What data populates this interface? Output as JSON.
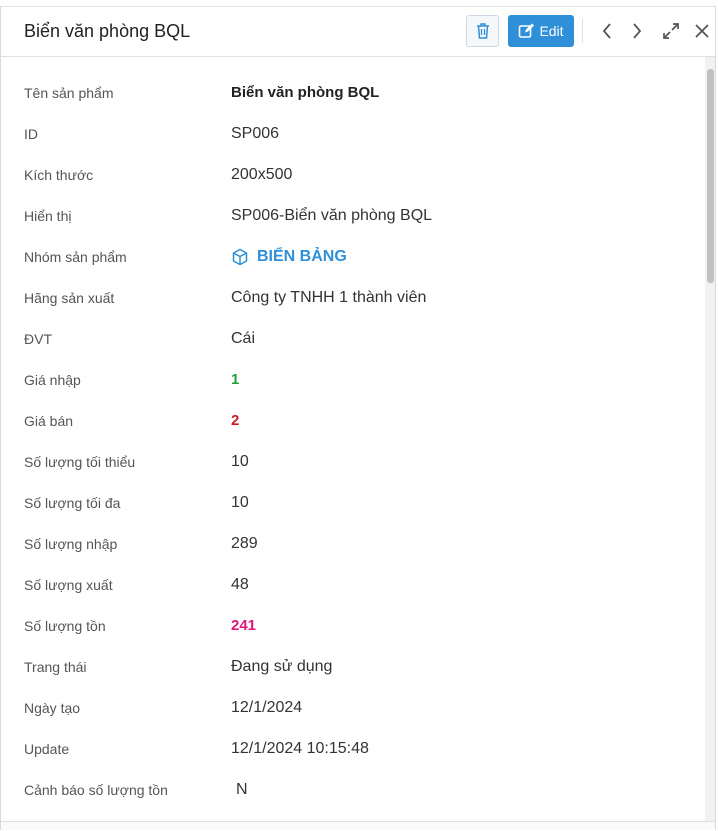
{
  "header": {
    "title": "Biển văn phòng BQL",
    "edit_label": "Edit"
  },
  "icons": {
    "delete": "trash-icon",
    "edit": "edit-icon",
    "prev": "chevron-left-icon",
    "next": "chevron-right-icon",
    "expand": "expand-icon",
    "close": "close-icon",
    "category": "cube-icon"
  },
  "colors": {
    "accent": "#2f8fd8",
    "green": "#23a03a",
    "red": "#d0192a",
    "pink": "#e0157a"
  },
  "fields": [
    {
      "label": "Tên sản phẩm",
      "value": "Biển văn phòng BQL"
    },
    {
      "label": "ID",
      "value": "SP006"
    },
    {
      "label": "Kích thước",
      "value": "200x500"
    },
    {
      "label": "Hiển thị",
      "value": "SP006-Biển văn phòng BQL"
    },
    {
      "label": "Nhóm sản phẩm",
      "value": "BIỂN BẢNG"
    },
    {
      "label": "Hãng sản xuất",
      "value": "Công ty TNHH 1 thành viên"
    },
    {
      "label": "ĐVT",
      "value": "Cái"
    },
    {
      "label": "Giá nhập",
      "value": "1"
    },
    {
      "label": "Giá bán",
      "value": "2"
    },
    {
      "label": "Số lượng tối thiểu",
      "value": "10"
    },
    {
      "label": "Số lượng tối đa",
      "value": "10"
    },
    {
      "label": "Số lượng nhập",
      "value": "289"
    },
    {
      "label": "Số lượng xuất",
      "value": "48"
    },
    {
      "label": "Số lượng tồn",
      "value": "241"
    },
    {
      "label": "Trang thái",
      "value": "Đang sử dụng"
    },
    {
      "label": "Ngày tạo",
      "value": "12/1/2024"
    },
    {
      "label": "Update",
      "value": "12/1/2024 10:15:48"
    },
    {
      "label": "Cảnh báo số lượng tồn",
      "value": "N"
    }
  ]
}
